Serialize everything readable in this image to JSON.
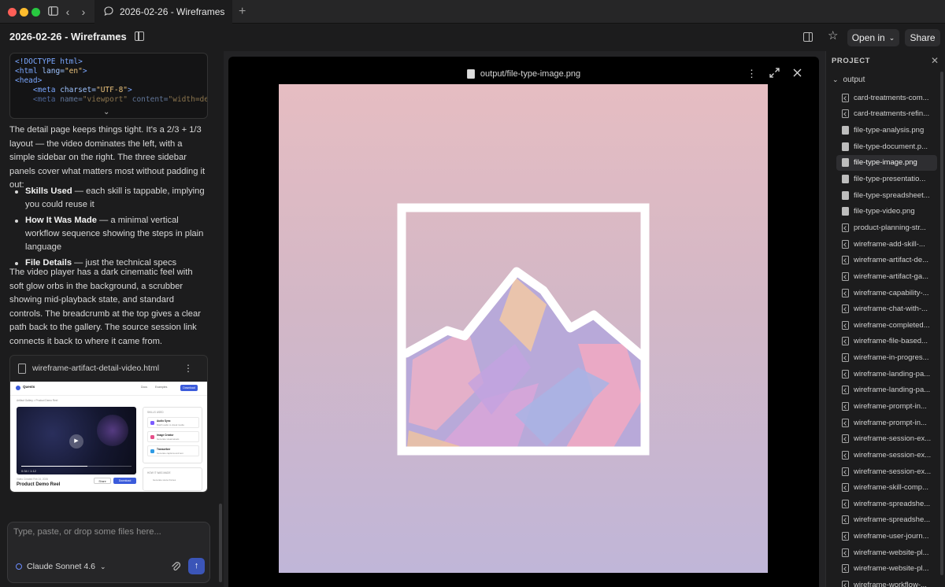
{
  "window": {
    "tab_title": "2026-02-26 - Wireframes"
  },
  "header": {
    "title": "2026-02-26 - Wireframes",
    "open_in_label": "Open in",
    "share_label": "Share"
  },
  "chat": {
    "code_lines": [
      [
        {
          "t": "<!DOCTYPE html>",
          "c": "c-tag"
        }
      ],
      [
        {
          "t": "<html ",
          "c": "c-tag"
        },
        {
          "t": "lang=",
          "c": "c-attr"
        },
        {
          "t": "\"en\"",
          "c": "c-str"
        },
        {
          "t": ">",
          "c": "c-tag"
        }
      ],
      [
        {
          "t": "<head>",
          "c": "c-tag"
        }
      ],
      [
        {
          "t": "    <meta ",
          "c": "c-tag"
        },
        {
          "t": "charset=",
          "c": "c-attr"
        },
        {
          "t": "\"UTF-8\"",
          "c": "c-str"
        },
        {
          "t": ">",
          "c": "c-tag"
        }
      ],
      [
        {
          "t": "    <meta ",
          "c": "c-tag"
        },
        {
          "t": "name=",
          "c": "c-attr"
        },
        {
          "t": "\"viewport\" ",
          "c": "c-str"
        },
        {
          "t": "content=",
          "c": "c-attr"
        },
        {
          "t": "\"width=devic",
          "c": "c-str"
        }
      ]
    ],
    "paragraph_1": "The detail page keeps things tight. It's a 2/3 + 1/3 layout — the video dominates the left, with a simple sidebar on the right. The three sidebar panels cover what matters most without padding it out:",
    "bullets": [
      {
        "bold": "Skills Used",
        "text": " — each skill is tappable, implying you could reuse it"
      },
      {
        "bold": "How It Was Made",
        "text": " — a minimal vertical workflow sequence showing the steps in plain language"
      },
      {
        "bold": "File Details",
        "text": " — just the technical specs"
      }
    ],
    "paragraph_2": "The video player has a dark cinematic feel with soft glow orbs in the background, a scrubber showing mid-playback state, and standard controls. The breadcrumb at the top gives a clear path back to the gallery. The source session link connects it back to where it came from.",
    "artifact": {
      "filename": "wireframe-artifact-detail-video.html",
      "thumb": {
        "brand": "Quests",
        "nav_links": [
          "Docs",
          "Examples"
        ],
        "download": "Download",
        "breadcrumb": "Artifact Gallery  >  Product Demo Reel",
        "time": "0:34 / 1:12",
        "meta": "Video   Created Feb 24, 2026",
        "title": "Product Demo Reel",
        "share": "Share",
        "download2": "Download",
        "skills_heading": "SKILLS USED",
        "skills": [
          {
            "title": "Audio Sync",
            "sub": "Match audio to visual media",
            "color": "#7c5cff"
          },
          {
            "title": "Image Creator",
            "sub": "Generate visual assets",
            "color": "#e5508a"
          },
          {
            "title": "Transcriber",
            "sub": "Generate captions and text",
            "color": "#2e9be5"
          }
        ],
        "how_heading": "HOW IT WAS MADE",
        "how_first": "Generate scene frames"
      }
    },
    "composer": {
      "placeholder": "Type, paste, or drop some files here...",
      "model": "Claude Sonnet 4.6"
    }
  },
  "viewer": {
    "file_path": "output/file-type-image.png",
    "image_colors": {
      "top": "#e6bdc2",
      "bottom": "#c0b6d8"
    }
  },
  "project": {
    "title": "PROJECT",
    "folder": "output",
    "active_index": 4,
    "files": [
      {
        "name": "card-treatments-com...",
        "type": "code"
      },
      {
        "name": "card-treatments-refin...",
        "type": "code"
      },
      {
        "name": "file-type-analysis.png",
        "type": "img"
      },
      {
        "name": "file-type-document.p...",
        "type": "img"
      },
      {
        "name": "file-type-image.png",
        "type": "img"
      },
      {
        "name": "file-type-presentatio...",
        "type": "img"
      },
      {
        "name": "file-type-spreadsheet...",
        "type": "img"
      },
      {
        "name": "file-type-video.png",
        "type": "img"
      },
      {
        "name": "product-planning-str...",
        "type": "code"
      },
      {
        "name": "wireframe-add-skill-...",
        "type": "code"
      },
      {
        "name": "wireframe-artifact-de...",
        "type": "code"
      },
      {
        "name": "wireframe-artifact-ga...",
        "type": "code"
      },
      {
        "name": "wireframe-capability-...",
        "type": "code"
      },
      {
        "name": "wireframe-chat-with-...",
        "type": "code"
      },
      {
        "name": "wireframe-completed...",
        "type": "code"
      },
      {
        "name": "wireframe-file-based...",
        "type": "code"
      },
      {
        "name": "wireframe-in-progres...",
        "type": "code"
      },
      {
        "name": "wireframe-landing-pa...",
        "type": "code"
      },
      {
        "name": "wireframe-landing-pa...",
        "type": "code"
      },
      {
        "name": "wireframe-prompt-in...",
        "type": "code"
      },
      {
        "name": "wireframe-prompt-in...",
        "type": "code"
      },
      {
        "name": "wireframe-session-ex...",
        "type": "code"
      },
      {
        "name": "wireframe-session-ex...",
        "type": "code"
      },
      {
        "name": "wireframe-session-ex...",
        "type": "code"
      },
      {
        "name": "wireframe-skill-comp...",
        "type": "code"
      },
      {
        "name": "wireframe-spreadshe...",
        "type": "code"
      },
      {
        "name": "wireframe-spreadshe...",
        "type": "code"
      },
      {
        "name": "wireframe-user-journ...",
        "type": "code"
      },
      {
        "name": "wireframe-website-pl...",
        "type": "code"
      },
      {
        "name": "wireframe-website-pl...",
        "type": "code"
      },
      {
        "name": "wireframe-workflow-...",
        "type": "code"
      }
    ]
  }
}
